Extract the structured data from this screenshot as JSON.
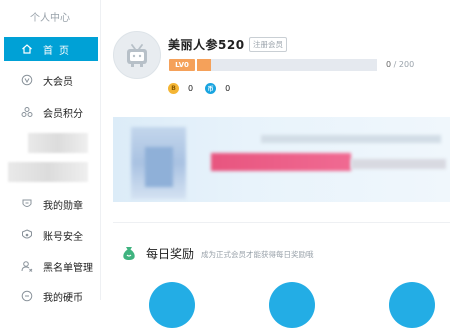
{
  "sidebar": {
    "title": "个人中心",
    "items": [
      {
        "label": "首页",
        "icon": "home-icon",
        "active": true
      },
      {
        "label": "大会员",
        "icon": "vip-icon"
      },
      {
        "label": "会员积分",
        "icon": "points-icon"
      },
      {
        "label": "我的勋章",
        "icon": "medal-icon"
      },
      {
        "label": "账号安全",
        "icon": "shield-icon"
      },
      {
        "label": "黑名单管理",
        "icon": "user-block-icon"
      },
      {
        "label": "我的硬币",
        "icon": "coin-icon"
      }
    ]
  },
  "profile": {
    "username": "美丽人参520",
    "member_type": "注册会员",
    "level": "LV0",
    "exp_current": "0",
    "exp_separator": "/",
    "exp_max": "200",
    "exp_progress": 0.08,
    "b_coins": "0",
    "coins": "0",
    "b_coin_icon": "B",
    "coin_icon": "币"
  },
  "daily_reward": {
    "title": "每日奖励",
    "subtitle": "成为正式会员才能获得每日奖励哦"
  },
  "colors": {
    "accent": "#00a1d6",
    "level_orange": "#f5a15a",
    "banner_pink": "#e8557f",
    "task_blue": "#23ade5"
  }
}
